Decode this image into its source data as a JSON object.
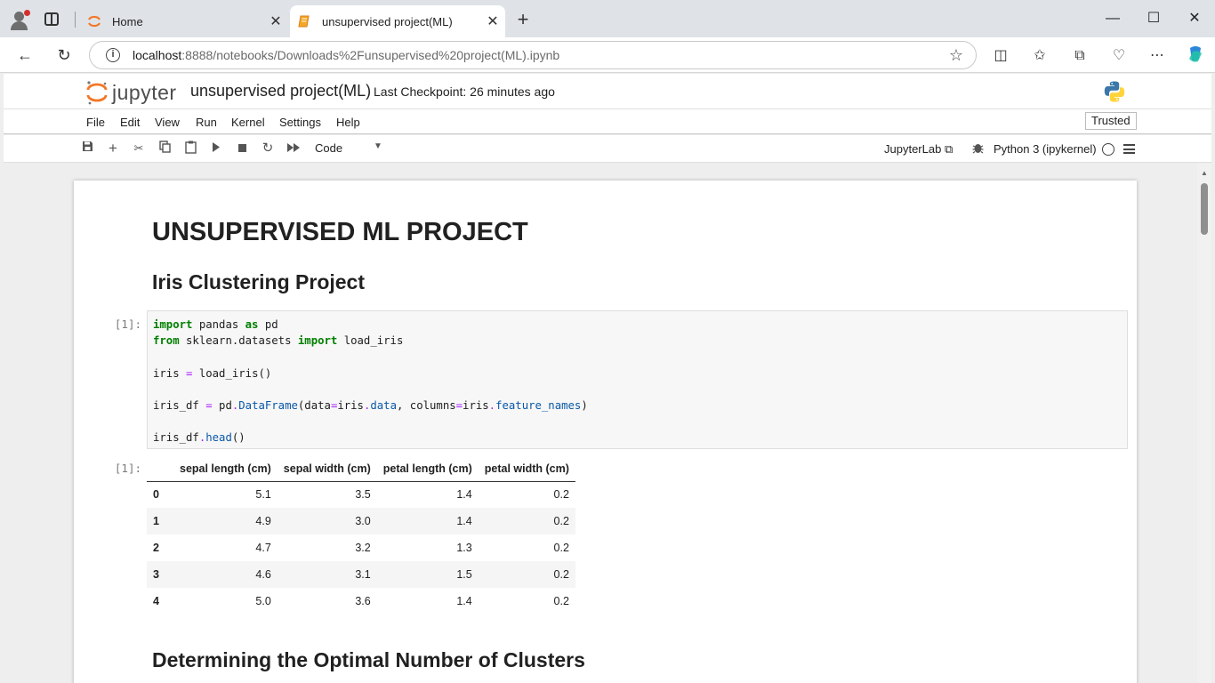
{
  "browser": {
    "tabs": [
      {
        "title": "Home",
        "active": false
      },
      {
        "title": "unsupervised project(ML)",
        "active": true
      }
    ],
    "url_host": "localhost",
    "url_path": ":8888/notebooks/Downloads%2Funsupervised%20project(ML).ipynb"
  },
  "jupyter": {
    "logo_text": "jupyter",
    "notebook_title": "unsupervised project(ML)",
    "checkpoint": "Last Checkpoint: 26 minutes ago",
    "menu": [
      "File",
      "Edit",
      "View",
      "Run",
      "Kernel",
      "Settings",
      "Help"
    ],
    "trusted": "Trusted",
    "cell_type": "Code",
    "jupyterlab_link": "JupyterLab",
    "kernel": "Python 3 (ipykernel)"
  },
  "notebook": {
    "h1": "UNSUPERVISED ML PROJECT",
    "h2": "Iris Clustering Project",
    "in_prompt": "[1]:",
    "out_prompt": "[1]:",
    "next_heading": "Determining the Optimal Number of Clusters",
    "dataframe": {
      "columns": [
        "sepal length (cm)",
        "sepal width (cm)",
        "petal length (cm)",
        "petal width (cm)"
      ],
      "rows": [
        {
          "index": "0",
          "values": [
            "5.1",
            "3.5",
            "1.4",
            "0.2"
          ]
        },
        {
          "index": "1",
          "values": [
            "4.9",
            "3.0",
            "1.4",
            "0.2"
          ]
        },
        {
          "index": "2",
          "values": [
            "4.7",
            "3.2",
            "1.3",
            "0.2"
          ]
        },
        {
          "index": "3",
          "values": [
            "4.6",
            "3.1",
            "1.5",
            "0.2"
          ]
        },
        {
          "index": "4",
          "values": [
            "5.0",
            "3.6",
            "1.4",
            "0.2"
          ]
        }
      ]
    }
  },
  "colors": {
    "keyword": "#008000",
    "operator": "#aa22ff",
    "attribute": "#0a58a8",
    "jupyter_orange": "#f37726"
  }
}
